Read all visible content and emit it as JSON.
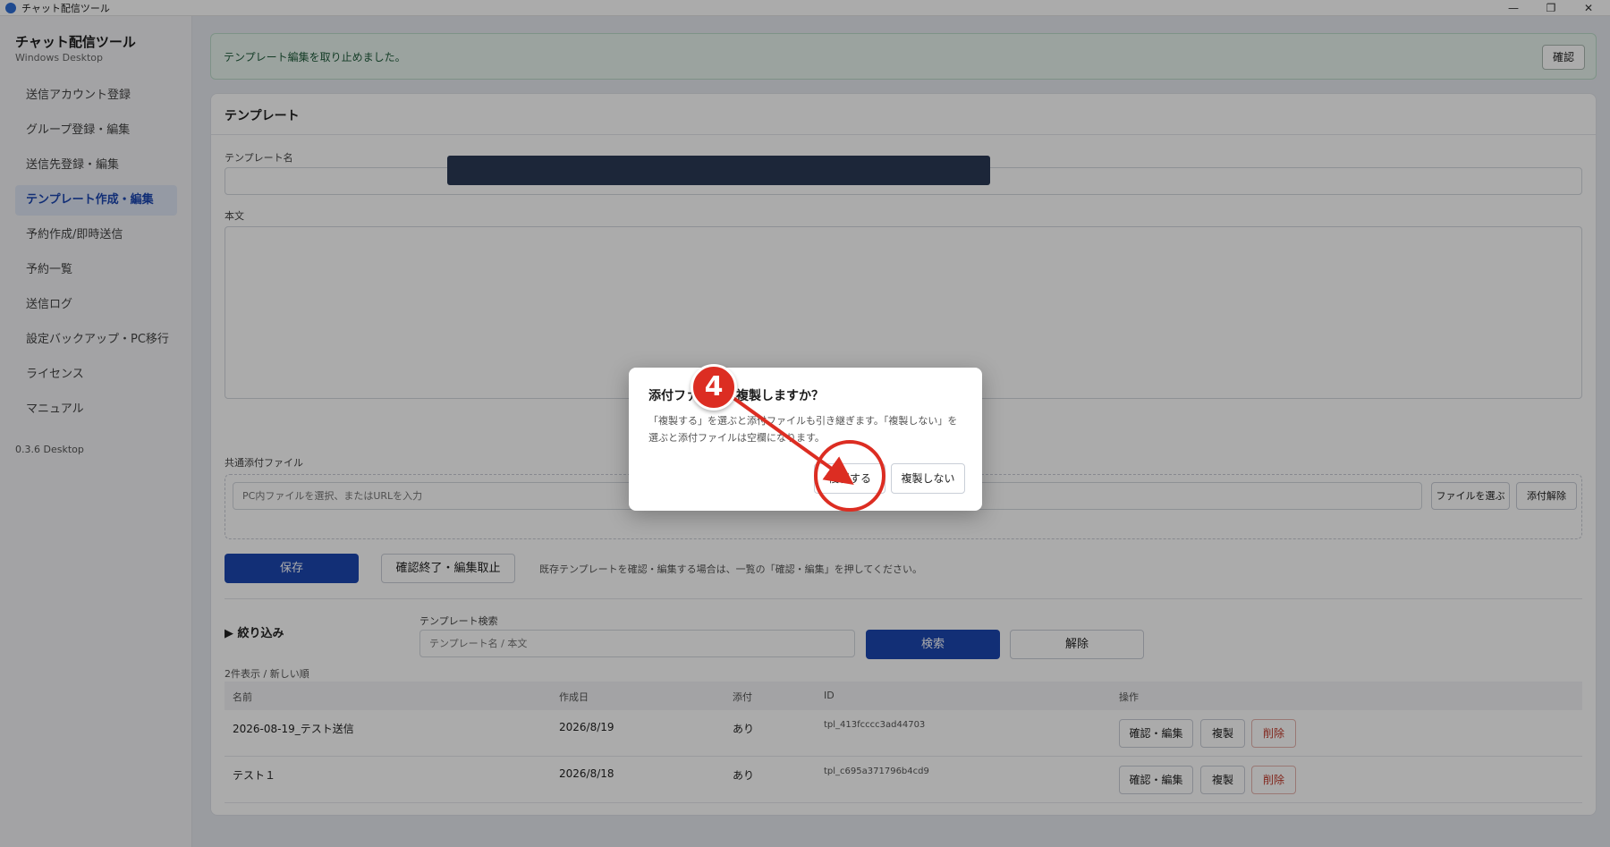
{
  "window": {
    "title": "チャット配信ツール",
    "controls": [
      "—",
      "❐",
      "✕"
    ]
  },
  "sidebar": {
    "brand": "チャット配信ツール",
    "subtitle": "Windows Desktop",
    "items": [
      {
        "label": "送信アカウント登録",
        "active": false
      },
      {
        "label": "グループ登録・編集",
        "active": false
      },
      {
        "label": "送信先登録・編集",
        "active": false
      },
      {
        "label": "テンプレート作成・編集",
        "active": true
      },
      {
        "label": "予約作成/即時送信",
        "active": false
      },
      {
        "label": "予約一覧",
        "active": false
      },
      {
        "label": "送信ログ",
        "active": false
      },
      {
        "label": "設定バックアップ・PC移行",
        "active": false
      },
      {
        "label": "ライセンス",
        "active": false
      },
      {
        "label": "マニュアル",
        "active": false
      }
    ],
    "version": "0.3.6 Desktop"
  },
  "notice": {
    "text": "テンプレート編集を取り止めました。",
    "button": "確認"
  },
  "template": {
    "heading": "テンプレート",
    "name_label": "テンプレート名",
    "name_value": "",
    "body_label": "本文",
    "attach_label": "共通添付ファイル",
    "attach_placeholder": "PC内ファイルを選択、またはURLを入力",
    "choose_file": "ファイルを選ぶ",
    "remove_attach": "添付解除",
    "save": "保存",
    "cancel_edit": "確認終了・編集取止",
    "hint": "既存テンプレートを確認・編集する場合は、一覧の「確認・編集」を押してください。"
  },
  "filter": {
    "label": "▶ 絞り込み",
    "search_label": "テンプレート検索",
    "search_placeholder": "テンプレート名 / 本文",
    "search_button": "検索",
    "clear_button": "解除",
    "count": "2件表示 / 新しい順"
  },
  "table": {
    "headers": [
      "名前",
      "作成日",
      "添付",
      "ID",
      "操作"
    ],
    "rows": [
      {
        "name": "2026-08-19_テスト送信",
        "date": "2026/8/19",
        "attach": "あり",
        "id": "tpl_413fcccc3ad44703"
      },
      {
        "name": "テスト１",
        "date": "2026/8/18",
        "attach": "あり",
        "id": "tpl_c695a371796b4cd9"
      }
    ],
    "actions": {
      "edit": "確認・編集",
      "copy": "複製",
      "delete": "削除"
    }
  },
  "dialog": {
    "title": "添付ファイルも複製しますか？",
    "body": "「複製する」を選ぶと添付ファイルも引き継ぎます。「複製しない」を選ぶと添付ファイルは空欄になります。",
    "yes": "複製する",
    "no": "複製しない"
  },
  "annotation": {
    "step": "4",
    "color": "#dc2d22"
  }
}
